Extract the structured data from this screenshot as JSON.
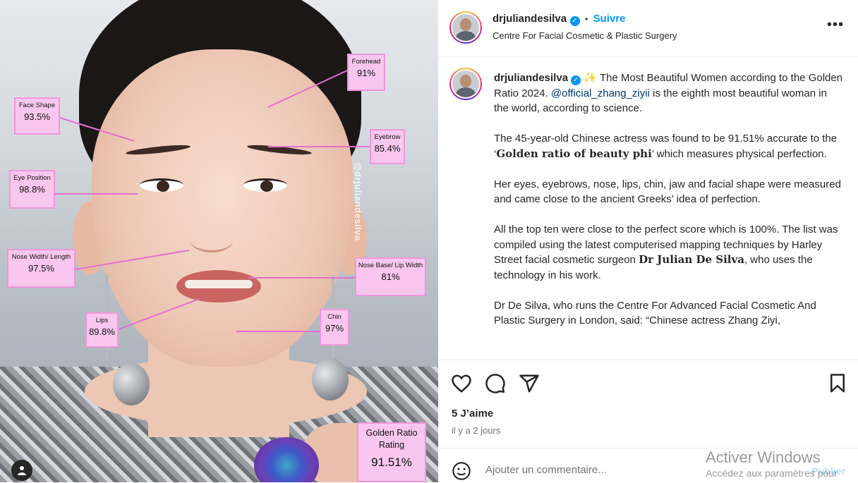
{
  "photo": {
    "watermark": "@drjuliandesilva",
    "labels": [
      {
        "id": "forehead",
        "title": "Forehead",
        "value": "91%"
      },
      {
        "id": "face-shape",
        "title": "Face Shape",
        "value": "93.5%"
      },
      {
        "id": "eyebrow",
        "title": "Eyebrow",
        "value": "85.4%"
      },
      {
        "id": "eye-position",
        "title": "Eye Position",
        "value": "98.8%"
      },
      {
        "id": "nose-width",
        "title": "Nose Width/ Length",
        "value": "97.5%"
      },
      {
        "id": "nose-base",
        "title": "Nose Base/ Lip Width",
        "value": "81%"
      },
      {
        "id": "lips",
        "title": "Lips",
        "value": "89.8%"
      },
      {
        "id": "chin",
        "title": "Chin",
        "value": "97%"
      },
      {
        "id": "golden",
        "title": "Golden Ratio Rating",
        "value": "91.51%"
      }
    ],
    "accent": "#f8c6ee",
    "line_color": "#e46fcf"
  },
  "header": {
    "username": "drjuliandesilva",
    "separator": "•",
    "follow_label": "Suivre",
    "subtitle": "Centre For Facial Cosmetic & Plastic Surgery",
    "more_icon": "more-horizontal-icon"
  },
  "caption": {
    "username": "drjuliandesilva",
    "sparkle": "✨",
    "p1_a": "The Most Beautiful Women according to the Golden Ratio 2024.",
    "mention": "@official_zhang_ziyii",
    "p1_b": "is the eighth most beautiful woman in the world, according to science.",
    "p2_a": "The 45-year-old Chinese actress was found to be 91.51% accurate to the ‘",
    "p2_bold": "Golden ratio of beauty phi",
    "p2_b": "’ which measures physical perfection.",
    "p3": "Her eyes, eyebrows, nose, lips, chin, jaw and facial shape were measured and came close to the ancient Greeks’ idea of perfection.",
    "p4_a": "All the top ten were close to the perfect score which is 100%. The list was compiled using the latest computerised mapping techniques by Harley Street facial cosmetic surgeon",
    "p4_bold": "Dr Julian De Silva",
    "p4_b": ", who uses the technology in his work.",
    "p5": "Dr De Silva, who runs the Centre For Advanced Facial Cosmetic And Plastic Surgery in London, said: “Chinese actress Zhang Ziyi,"
  },
  "actions": {
    "likes": "5 J’aime",
    "date": "il y a 2 jours"
  },
  "comment": {
    "placeholder": "Ajouter un commentaire...",
    "publish": "Publier"
  },
  "windows": {
    "line1": "Activer Windows",
    "line2": "Accédez aux paramètres pour"
  },
  "colors": {
    "link": "#0095f6",
    "mention": "#00376b",
    "secondary": "#737373"
  }
}
